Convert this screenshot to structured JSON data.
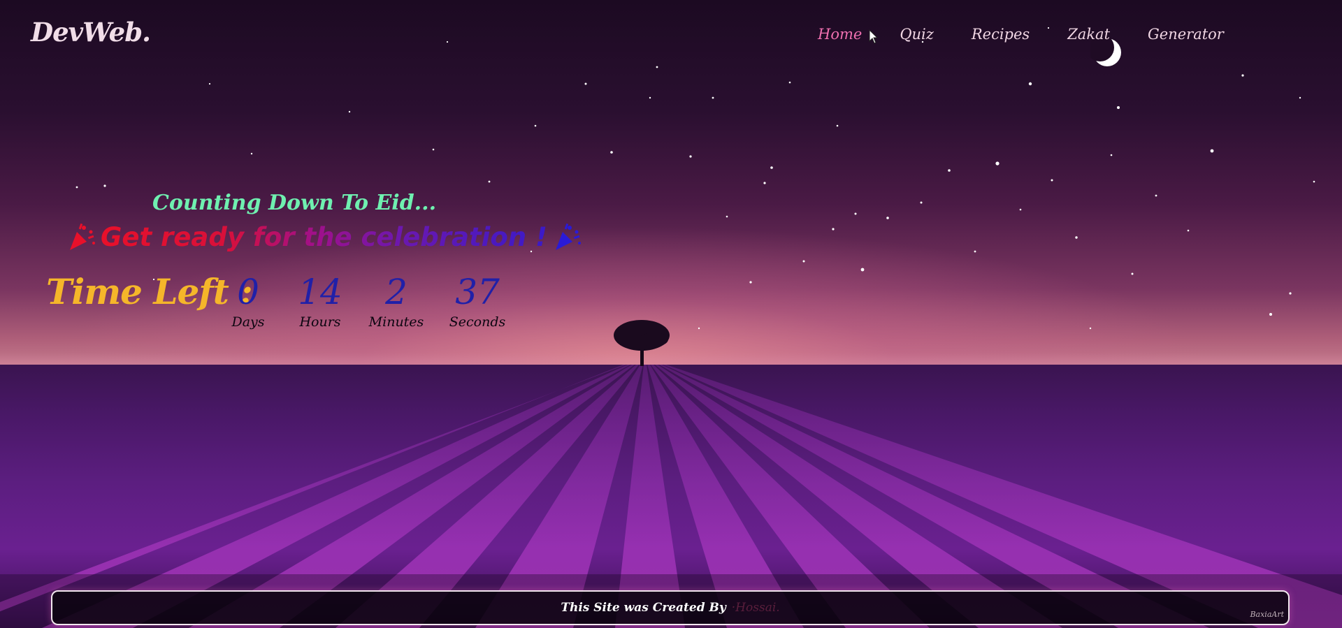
{
  "brand": {
    "logo_text": "DevWeb."
  },
  "nav": {
    "items": [
      {
        "label": "Home",
        "active": true
      },
      {
        "label": "Quiz",
        "active": false
      },
      {
        "label": "Recipes",
        "active": false
      },
      {
        "label": "Zakat",
        "active": false
      },
      {
        "label": "Generator",
        "active": false
      }
    ]
  },
  "hero": {
    "subtitle": "Counting Down To Eid...",
    "headline": "Get ready for the celebration !",
    "time_left_label": "Time Left :",
    "countdown": [
      {
        "value": "0",
        "unit": "Days"
      },
      {
        "value": "14",
        "unit": "Hours"
      },
      {
        "value": "2",
        "unit": "Minutes"
      },
      {
        "value": "37",
        "unit": "Seconds"
      }
    ]
  },
  "footer": {
    "created_by_text": "This Site was Created By",
    "author": "·Hossai.",
    "watermark": "BaxiaArt"
  },
  "colors": {
    "nav_active": "#f070b0",
    "nav_default": "#f0d6e3",
    "subtitle": "#6ff0b0",
    "time_left": "#f5b62a",
    "countdown_value": "#2020a8",
    "headline_gradient_start": "#e8102a",
    "headline_gradient_end": "#3a1ac8"
  },
  "icons": {
    "moon": "crescent-moon-icon",
    "cursor": "mouse-pointer-icon",
    "confetti": "party-popper-icon",
    "tree": "lone-tree-icon"
  }
}
